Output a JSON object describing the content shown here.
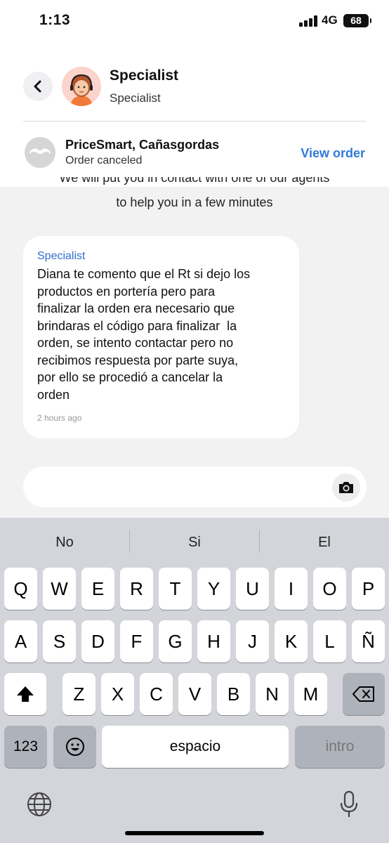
{
  "status_bar": {
    "time": "1:13",
    "network": "4G",
    "battery": "68"
  },
  "header": {
    "back_icon": "chevron-left-icon",
    "agent_name": "Specialist",
    "agent_role": "Specialist",
    "store_name": "PriceSmart, Cañasgordas",
    "order_status": "Order canceled",
    "view_order_label": "View order"
  },
  "chat": {
    "intro_cut": "We will put you in contact with one of our agents",
    "intro": "to help you in a few minutes",
    "messages": [
      {
        "sender": "Specialist",
        "lines": [
          "Diana te comento que el Rt si dejo los",
          "productos en portería pero para",
          "finalizar la orden era necesario que",
          "brindaras el código para finalizar  la",
          "orden, se intento contactar pero no",
          "recibimos respuesta por parte suya,",
          "por ello se procedió a cancelar la",
          "orden"
        ],
        "time": "2 hours ago"
      }
    ],
    "input_value": "",
    "camera_icon": "camera-icon"
  },
  "keyboard": {
    "suggestions": [
      "No",
      "Si",
      "El"
    ],
    "row1": [
      "Q",
      "W",
      "E",
      "R",
      "T",
      "Y",
      "U",
      "I",
      "O",
      "P"
    ],
    "row2": [
      "A",
      "S",
      "D",
      "F",
      "G",
      "H",
      "J",
      "K",
      "L",
      "Ñ"
    ],
    "row3": [
      "Z",
      "X",
      "C",
      "V",
      "B",
      "N",
      "M"
    ],
    "numbers_label": "123",
    "space_label": "espacio",
    "return_label": "intro",
    "icons": [
      "shift-icon",
      "backspace-icon",
      "emoji-icon",
      "globe-icon",
      "microphone-icon"
    ]
  }
}
